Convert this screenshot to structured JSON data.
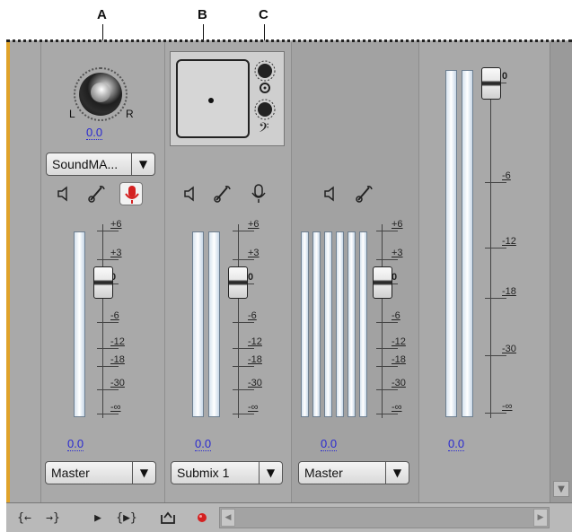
{
  "callouts": [
    "A",
    "B",
    "C"
  ],
  "pan_knob": {
    "left_label": "L",
    "right_label": "R",
    "value": "0.0"
  },
  "track1": {
    "effect_dropdown": "SoundMA...",
    "volume": "0.0",
    "output": "Master",
    "record_armed": true
  },
  "track2": {
    "volume": "0.0",
    "output": "Submix 1"
  },
  "track3": {
    "volume": "0.0",
    "output": "Master"
  },
  "master": {
    "volume": "0.0",
    "scale": [
      "0",
      "-6",
      "-12",
      "-18",
      "-30",
      "-∞"
    ]
  },
  "track_scale": [
    "+6",
    "+3",
    "0",
    "-6",
    "-12",
    "-18",
    "-30",
    "-∞"
  ],
  "colors": {
    "panel": "#a9a9a9",
    "amber": "#e0a32a",
    "record_red": "#d42020",
    "link_blue": "#2a2ad0"
  },
  "icons": {
    "mute": "speaker-icon",
    "solo": "headphone-icon",
    "record": "microphone-icon",
    "transport": [
      "go-to-in-icon",
      "go-to-out-icon",
      "play-icon",
      "play-in-to-out-icon",
      "loop-icon",
      "record-icon"
    ]
  }
}
